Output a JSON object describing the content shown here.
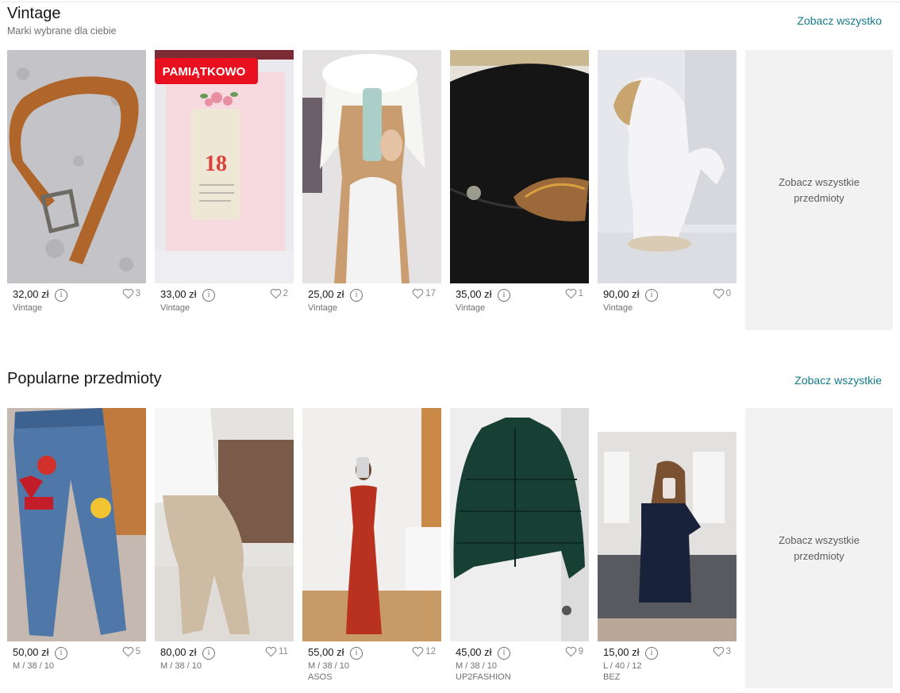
{
  "sections": [
    {
      "title": "Vintage",
      "subtitle": "Marki wybrane dla ciebie",
      "see_all": "Zobacz wszystko",
      "more_card": "Zobacz wszystkie przedmioty",
      "items": [
        {
          "price": "32,00 zł",
          "likes": "3",
          "line1": "Vintage",
          "line2": "",
          "image": "brown-leather-belt"
        },
        {
          "price": "33,00 zł",
          "likes": "2",
          "line1": "Vintage",
          "line2": "",
          "image": "framed-calendar-page",
          "badge": "PAMIĄTKOWO",
          "calendar_day": "18"
        },
        {
          "price": "25,00 zł",
          "likes": "17",
          "line1": "Vintage",
          "line2": "",
          "image": "white-fur-trapper-hat"
        },
        {
          "price": "35,00 zł",
          "likes": "1",
          "line1": "Vintage",
          "line2": "",
          "image": "black-felt-hat"
        },
        {
          "price": "90,00 zł",
          "likes": "0",
          "line1": "Vintage",
          "line2": "",
          "image": "porcelain-horse"
        }
      ]
    },
    {
      "title": "Popularne przedmioty",
      "subtitle": "",
      "see_all": "Zobacz wszystkie",
      "more_card": "Zobacz wszystkie przedmioty",
      "items": [
        {
          "price": "50,00 zł",
          "likes": "5",
          "line1": "M / 38 / 10",
          "line2": "",
          "image": "patched-jeans"
        },
        {
          "price": "80,00 zł",
          "likes": "11",
          "line1": "M / 38 / 10",
          "line2": "",
          "image": "beige-leggings"
        },
        {
          "price": "55,00 zł",
          "likes": "12",
          "line1": "M / 38 / 10",
          "line2": "ASOS",
          "image": "red-satin-dress"
        },
        {
          "price": "45,00 zł",
          "likes": "9",
          "line1": "M / 38 / 10",
          "line2": "UP2FASHION",
          "image": "green-puffer-jacket"
        },
        {
          "price": "15,00 zł",
          "likes": "3",
          "line1": "L / 40 / 12",
          "line2": "BEZ",
          "image": "navy-dress"
        }
      ]
    }
  ],
  "icons": {
    "info": "info-icon",
    "favourite": "heart-icon"
  },
  "colors": {
    "link": "#157a8a",
    "badge": "#e8101f",
    "more_card_bg": "#f2f2f2"
  }
}
